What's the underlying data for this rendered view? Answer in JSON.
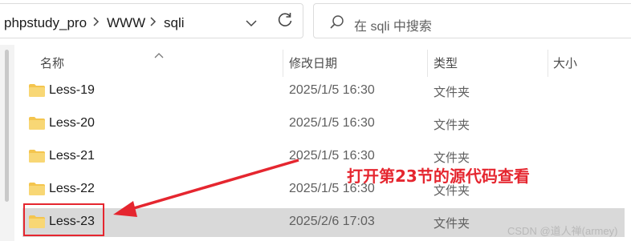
{
  "breadcrumb": {
    "items": [
      "phpstudy_pro",
      "WWW",
      "sqli"
    ]
  },
  "search": {
    "placeholder": "在 sqli 中搜索"
  },
  "columns": {
    "name": "名称",
    "modified": "修改日期",
    "type": "类型",
    "size": "大小"
  },
  "files": [
    {
      "name": "Less-19",
      "modified": "2025/1/5 16:30",
      "type": "文件夹"
    },
    {
      "name": "Less-20",
      "modified": "2025/1/5 16:30",
      "type": "文件夹"
    },
    {
      "name": "Less-21",
      "modified": "2025/1/5 16:30",
      "type": "文件夹"
    },
    {
      "name": "Less-22",
      "modified": "2025/1/5 16:30",
      "type": "文件夹"
    },
    {
      "name": "Less-23",
      "modified": "2025/2/6 17:03",
      "type": "文件夹"
    }
  ],
  "annotation": {
    "text": "打开第23节的源代码查看",
    "color": "#e5262f"
  },
  "watermark": "CSDN @道人禅(armey)",
  "colors": {
    "selected_row": "#d9d9d9",
    "folder": "#f4c54e",
    "accent": "#e5262f"
  },
  "icons": {
    "breadcrumb_separator": "chevron-right-icon",
    "history": "chevron-down-icon",
    "refresh": "refresh-icon",
    "search": "search-icon",
    "folder": "folder-icon",
    "sort": "sort-up-icon"
  }
}
